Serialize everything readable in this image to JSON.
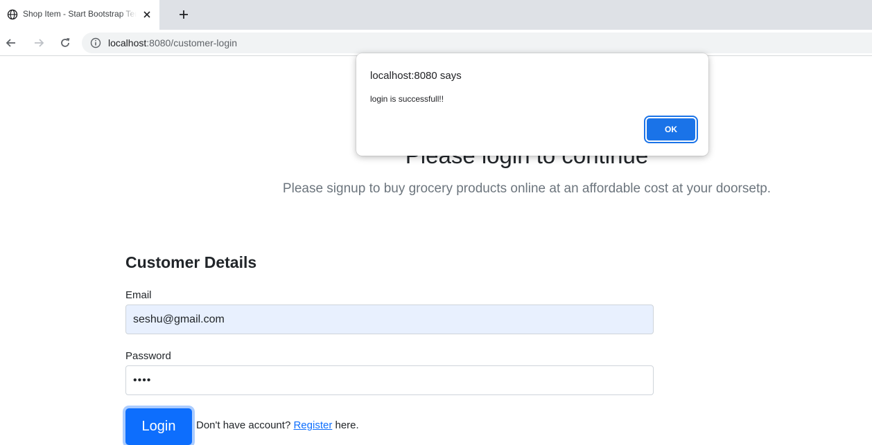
{
  "browser": {
    "tab": {
      "title": "Shop Item - Start Bootstrap Template",
      "favicon": "globe-icon"
    },
    "url": {
      "host": "localhost",
      "path": ":8080/customer-login"
    }
  },
  "page": {
    "hero_title": "Please login to continue",
    "hero_lead": "Please signup to buy grocery products online at an affordable cost at your doorsetp.",
    "form": {
      "section_title": "Customer Details",
      "email_label": "Email",
      "email_value": "seshu@gmail.com",
      "password_label": "Password",
      "password_value": "••••",
      "login_label": "Login",
      "register_prefix": "Don't have account? ",
      "register_link": "Register",
      "register_suffix": " here."
    }
  },
  "dialog": {
    "title": "localhost:8080 says",
    "message": "login is successfull!!",
    "ok_label": "OK"
  },
  "colors": {
    "primary": "#0d6efd",
    "dialog_button": "#1a73e8",
    "autofill_background": "#e8f0fe"
  }
}
